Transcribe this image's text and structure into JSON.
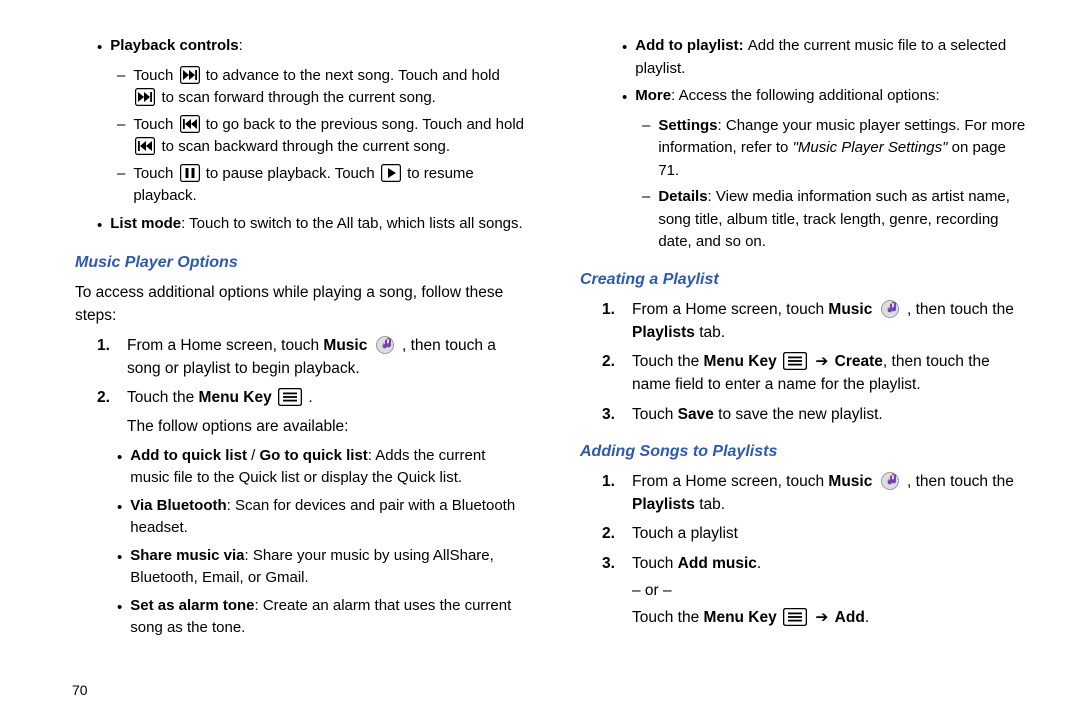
{
  "pageNumber": "70",
  "left": {
    "pb_label": "Playback controls",
    "pb_colon": ":",
    "pb_sub1_a": "Touch ",
    "pb_sub1_b": " to advance to the next song. Touch and hold ",
    "pb_sub1_c": " to scan forward through the current song.",
    "pb_sub2_a": "Touch ",
    "pb_sub2_b": " to go back to the previous song. Touch and hold ",
    "pb_sub2_c": " to scan backward through the current song.",
    "pb_sub3_a": "Touch ",
    "pb_sub3_b": " to pause playback. Touch ",
    "pb_sub3_c": " to resume playback.",
    "list_label": "List mode",
    "list_text": ": Touch to switch to the All tab, which lists all songs.",
    "h_options": "Music Player Options",
    "options_intro": "To access additional options while playing a song, follow these steps:",
    "step1_a": "From a Home screen, touch ",
    "step1_b": "Music",
    "step1_c": " , then touch a song or playlist to begin playback.",
    "step2_a": "Touch the ",
    "step2_b": "Menu Key",
    "step2_c": " .",
    "step2_after": "The follow options are available:",
    "opt1_b1": "Add to quick list",
    "opt1_slash": " / ",
    "opt1_b2": "Go to quick list",
    "opt1_rest": ": Adds the current music file to the Quick list or display the Quick list.",
    "opt2_b": "Via Bluetooth",
    "opt2_rest": ": Scan for devices and pair with a Bluetooth headset.",
    "opt3_b": "Share music via",
    "opt3_rest": ": Share your music by using AllShare, Bluetooth, Email, or Gmail.",
    "opt4_b": "Set as alarm tone",
    "opt4_rest": ": Create an alarm that uses the current song as the tone."
  },
  "right": {
    "opt5_b": "Add to playlist: ",
    "opt5_rest": "Add the current music file to a selected playlist.",
    "opt6_b": "More",
    "opt6_rest": ": Access the following additional options:",
    "sub1_b": "Settings",
    "sub1_rest_a": ": Change your music player settings. For more information, refer to ",
    "sub1_i": "\"Music Player Settings\"",
    "sub1_rest_b": "  on page 71.",
    "sub2_b": "Details",
    "sub2_rest": ": View media information such as artist name, song title, album title, track length, genre, recording date, and so on.",
    "h_create": "Creating a Playlist",
    "c1_a": "From a Home screen, touch ",
    "c1_b": "Music",
    "c1_c": " , then touch the ",
    "c1_d": "Playlists",
    "c1_e": " tab.",
    "c2_a": "Touch the ",
    "c2_b": "Menu Key",
    "c2_arrow": " ➔ ",
    "c2_d": "Create",
    "c2_e": ", then touch the name field to enter a name for the playlist.",
    "c3_a": "Touch ",
    "c3_b": "Save",
    "c3_c": " to save the new playlist.",
    "h_add": "Adding Songs to Playlists",
    "a1_a": "From a Home screen, touch ",
    "a1_b": "Music",
    "a1_c": " , then touch the ",
    "a1_d": "Playlists",
    "a1_e": " tab.",
    "a2": "Touch a playlist",
    "a3_a": "Touch ",
    "a3_b": "Add music",
    "a3_c": ".",
    "a3_or": "– or –",
    "a3_d": "Touch the ",
    "a3_e": "Menu Key",
    "a3_arrow": " ➔ ",
    "a3_f": "Add",
    "a3_g": "."
  }
}
